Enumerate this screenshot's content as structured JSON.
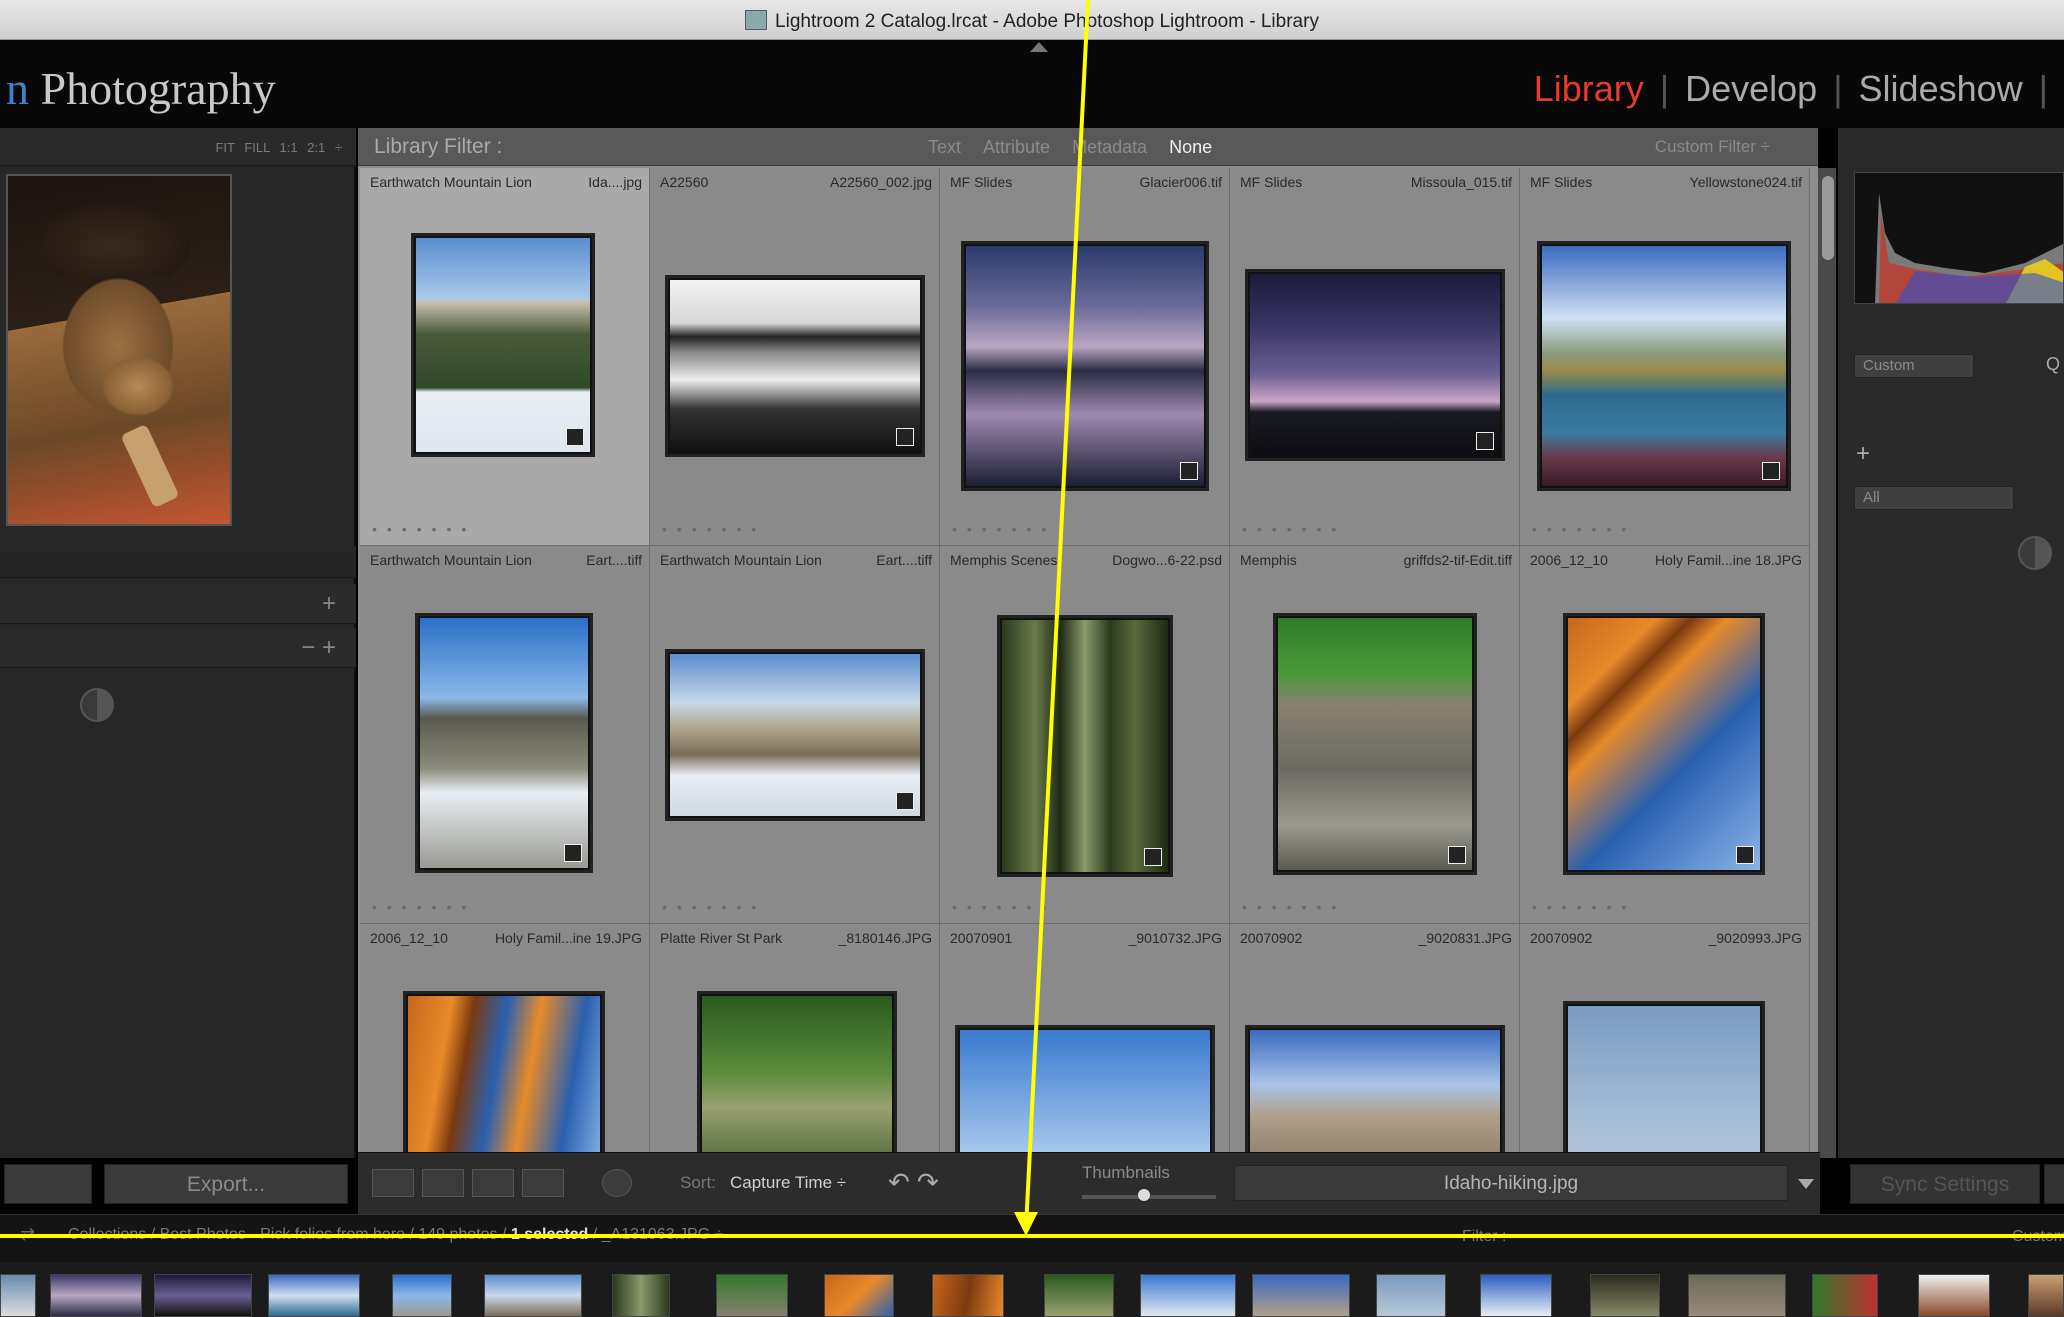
{
  "window": {
    "title": "Lightroom 2 Catalog.lrcat - Adobe Photoshop Lightroom - Library"
  },
  "identity": {
    "brand_prefix": "n",
    "brand_rest": " Photography"
  },
  "modules": [
    {
      "label": "Library",
      "active": true
    },
    {
      "label": "Develop",
      "active": false
    },
    {
      "label": "Slideshow",
      "active": false
    }
  ],
  "navigator": {
    "zoom_options": "FIT FILL 1:1 2:1 ÷"
  },
  "left_panel": {
    "export_label": "Export..."
  },
  "library_filter": {
    "label": "Library Filter :",
    "options": [
      "Text",
      "Attribute",
      "Metadata",
      "None"
    ],
    "active_option": "None",
    "preset": "Custom Filter ÷"
  },
  "grid": [
    {
      "folder": "Earthwatch Mountain Lion",
      "file": "Ida....jpg",
      "selected": true
    },
    {
      "folder": "A22560",
      "file": "A22560_002.jpg"
    },
    {
      "folder": "MF Slides",
      "file": "Glacier006.tif"
    },
    {
      "folder": "MF Slides",
      "file": "Missoula_015.tif"
    },
    {
      "folder": "MF Slides",
      "file": "Yellowstone024.tif"
    },
    {
      "folder": "Earthwatch Mountain Lion",
      "file": "Eart....tiff"
    },
    {
      "folder": "Earthwatch Mountain Lion",
      "file": "Eart....tiff"
    },
    {
      "folder": "Memphis Scenes",
      "file": "Dogwo...6-22.psd"
    },
    {
      "folder": "Memphis",
      "file": "griffds2-tif-Edit.tiff"
    },
    {
      "folder": "2006_12_10",
      "file": "Holy Famil...ine 18.JPG"
    },
    {
      "folder": "2006_12_10",
      "file": "Holy Famil...ine 19.JPG"
    },
    {
      "folder": "Platte River St Park",
      "file": "_8180146.JPG"
    },
    {
      "folder": "20070901",
      "file": "_9010732.JPG"
    },
    {
      "folder": "20070902",
      "file": "_9020831.JPG"
    },
    {
      "folder": "20070902",
      "file": "_9020993.JPG"
    }
  ],
  "toolbar": {
    "sort_label": "Sort:",
    "sort_value": "Capture Time ÷",
    "thumbnails_label": "Thumbnails",
    "thumbnail_size": 0.45,
    "filename": "Idaho-hiking.jpg"
  },
  "right_panel": {
    "preset_select": "Custom",
    "q_label": "Q",
    "plus": "+",
    "all_select": "All",
    "sync_label": "Sync Settings"
  },
  "filmstrip": {
    "path_prefix": "Collections / Best Photos - Pick folios from here / 149 photos /",
    "selected_text": "1 selected",
    "path_suffix": "/ _A131063.JPG ÷",
    "filter_label": "Filter :",
    "custom_label": "Custom"
  },
  "colors": {
    "active_module": "#e83b2e",
    "annotation": "#ffff00"
  }
}
